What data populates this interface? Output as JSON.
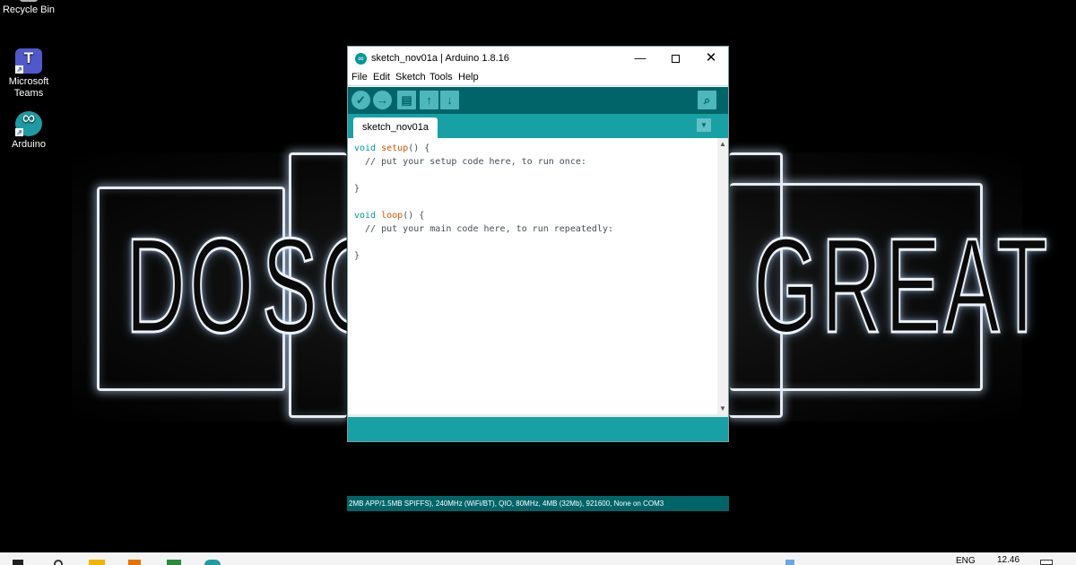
{
  "desktop": {
    "icons": [
      {
        "label": "Recycle Bin"
      },
      {
        "label": "Microsoft Teams"
      },
      {
        "label": "Arduino"
      }
    ],
    "wallpaper": {
      "words": [
        "DO",
        "SO",
        "GREAT"
      ]
    }
  },
  "window": {
    "title": "sketch_nov01a | Arduino 1.8.16",
    "controls": {
      "minimize": "—",
      "close": "✕"
    },
    "menu": [
      "File",
      "Edit",
      "Sketch",
      "Tools",
      "Help"
    ],
    "toolbar": {
      "verify_icon": "check-icon",
      "upload_icon": "arrow-right-icon",
      "new_icon": "document-icon",
      "open_icon": "arrow-up-icon",
      "save_icon": "arrow-down-icon",
      "monitor_icon": "magnifier-icon"
    },
    "tab": {
      "label": "sketch_nov01a"
    },
    "code": [
      {
        "kw": "void",
        "fn": "setup",
        "rest": "() {"
      },
      {
        "cm": "  // put your setup code here, to run once:"
      },
      {
        "cm": ""
      },
      {
        "cm": "}"
      },
      {
        "cm": ""
      },
      {
        "kw": "void",
        "fn": "loop",
        "rest": "() {"
      },
      {
        "cm": "  // put your main code here, to run repeatedly:"
      },
      {
        "cm": ""
      },
      {
        "cm": "}"
      }
    ],
    "status_line": "2MB APP/1.5MB SPIFFS), 240MHz (WiFi/BT), QIO, 80MHz, 4MB (32Mb), 921600, None on COM3"
  },
  "taskbar": {
    "language": "ENG",
    "time": "12.46"
  },
  "colors": {
    "arduino_dark": "#006468",
    "arduino_teal": "#17a1a5",
    "keyword": "#00979c",
    "function": "#d35400"
  }
}
